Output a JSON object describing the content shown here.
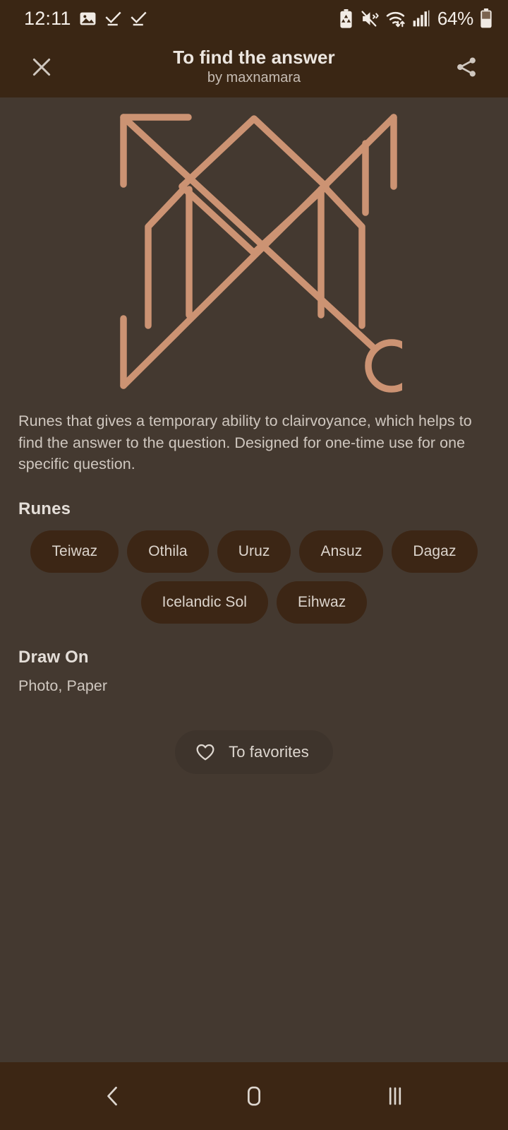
{
  "status_bar": {
    "clock": "12:11",
    "battery_percent": "64%",
    "icons": [
      "photo-icon",
      "check-underline-icon",
      "check-underline-icon"
    ],
    "right_icons": [
      "battery-saver-icon",
      "mute-vibrate-icon",
      "wifi-transfer-icon",
      "cellular-signal-icon",
      "battery-icon"
    ]
  },
  "app_bar": {
    "close_icon": "close-icon",
    "title": "To find the answer",
    "subtitle": "by maxnamara",
    "share_icon": "share-icon"
  },
  "sigil": {
    "name": "rune-sigil-diagram",
    "stroke_color": "#cc9373",
    "background_color": "#443930"
  },
  "description": "Runes that gives a temporary ability to clairvoyance, which helps to find the answer to the question. Designed for one-time use for one specific question.",
  "runes_section": {
    "title": "Runes",
    "chips": [
      "Teiwaz",
      "Othila",
      "Uruz",
      "Ansuz",
      "Dagaz",
      "Icelandic Sol",
      "Eihwaz"
    ]
  },
  "draw_on_section": {
    "title": "Draw On",
    "value": "Photo, Paper"
  },
  "favorites_button": {
    "label": "To favorites",
    "icon": "heart-outline-icon"
  },
  "nav_bar": {
    "back": "back-icon",
    "home": "home-icon",
    "recents": "recents-icon"
  },
  "colors": {
    "background": "#443930",
    "bar_background": "#3a2614",
    "chip_background": "#3c2615",
    "accent": "#cc9373",
    "text_primary": "#e4ded8",
    "text_secondary": "#cfc7bf"
  }
}
